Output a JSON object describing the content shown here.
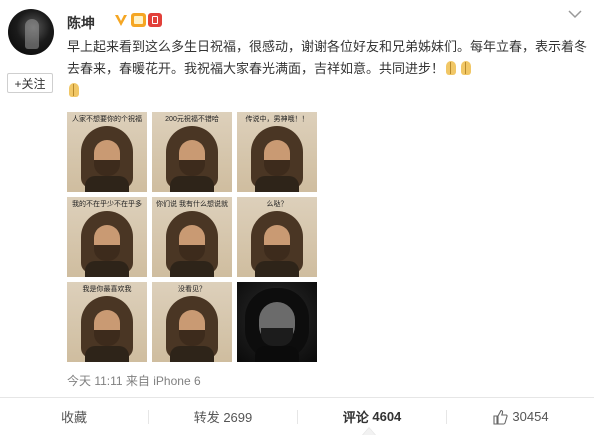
{
  "post": {
    "author": "陈坤",
    "follow_label": "+关注",
    "text": "早上起来看到这么多生日祝福，很感动，谢谢各位好友和兄弟姊妹们。每年立春，表示着冬去春来，春暖花开。我祝福大家春光满面，吉祥如意。共同进步！",
    "meta": "今天 11:11 来自 iPhone 6",
    "colors": {
      "accent": "#f28c28",
      "verified": "#f5a623",
      "text": "#333333",
      "muted": "#808080"
    }
  },
  "images": [
    {
      "caption": "人家不想要你的个祝福",
      "dark": false
    },
    {
      "caption": "200元祝福不错哈",
      "dark": false
    },
    {
      "caption": "传说中，男神哦！！",
      "dark": false
    },
    {
      "caption": "我的不在乎少不在乎多",
      "dark": false
    },
    {
      "caption": "你们说 我有什么想说就说一下",
      "dark": false
    },
    {
      "caption": "么哒？",
      "dark": false
    },
    {
      "caption": "我是你最喜欢我",
      "dark": false
    },
    {
      "caption": "没看见？",
      "dark": false
    },
    {
      "caption": "",
      "dark": true
    }
  ],
  "actions": {
    "favorite": "收藏",
    "repost": "转发 2699",
    "comment_label": "评论",
    "comment_count": "4604",
    "like": "30454"
  }
}
